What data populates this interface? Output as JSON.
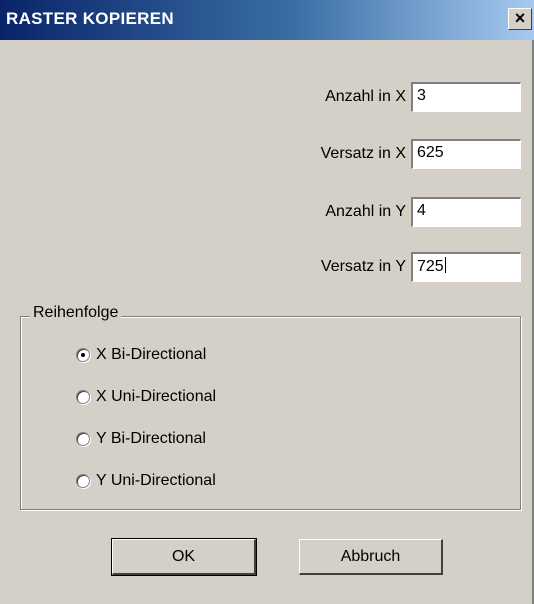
{
  "window": {
    "title": "RASTER KOPIEREN",
    "close_glyph": "×"
  },
  "fields": [
    {
      "label": "Anzahl in X",
      "value": "3"
    },
    {
      "label": "Versatz in X",
      "value": "625"
    },
    {
      "label": "Anzahl in Y",
      "value": "4"
    },
    {
      "label": "Versatz in Y",
      "value": "725"
    }
  ],
  "order_group": {
    "title": "Reihenfolge",
    "options": [
      {
        "label": "X Bi-Directional",
        "selected": true
      },
      {
        "label": "X Uni-Directional",
        "selected": false
      },
      {
        "label": "Y Bi-Directional",
        "selected": false
      },
      {
        "label": "Y Uni-Directional",
        "selected": false
      }
    ]
  },
  "buttons": {
    "ok": "OK",
    "cancel": "Abbruch"
  },
  "colors": {
    "dialog_bg": "#d4d0c8",
    "title_start": "#0a246a",
    "title_end": "#a6caf0"
  }
}
